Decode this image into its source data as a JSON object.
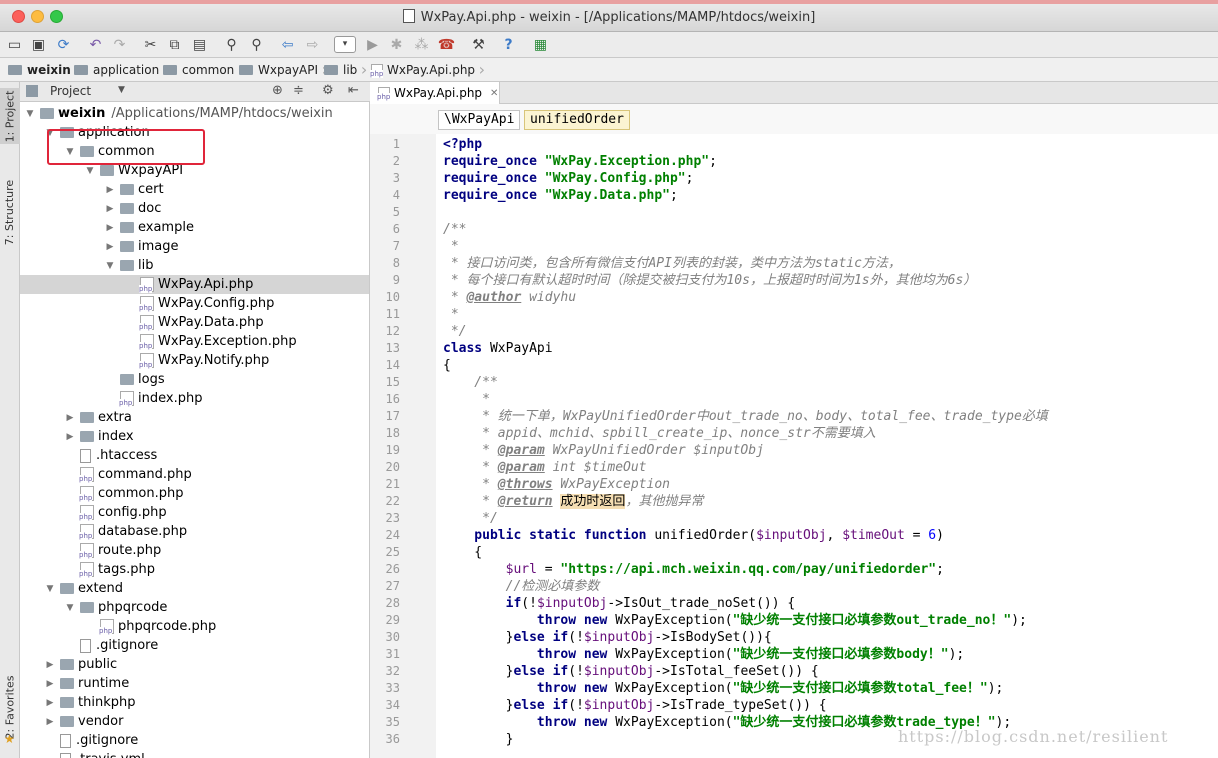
{
  "window": {
    "title": "WxPay.Api.php - weixin - [/Applications/MAMP/htdocs/weixin]"
  },
  "breadcrumbs": [
    "weixin",
    "application",
    "common",
    "WxpayAPI",
    "lib",
    "WxPay.Api.php"
  ],
  "left_tabs": {
    "project": "1: Project",
    "structure": "7: Structure",
    "favorites": "2: Favorites"
  },
  "project_panel": {
    "title": "Project",
    "root_name": "weixin",
    "root_path": "/Applications/MAMP/htdocs/weixin",
    "tree": [
      {
        "label": "application",
        "kind": "folder",
        "depth": 1,
        "open": true
      },
      {
        "label": "common",
        "kind": "folder",
        "depth": 2,
        "open": true
      },
      {
        "label": "WxpayAPI",
        "kind": "folder",
        "depth": 3,
        "open": true
      },
      {
        "label": "cert",
        "kind": "folder",
        "depth": 4,
        "open": false
      },
      {
        "label": "doc",
        "kind": "folder",
        "depth": 4,
        "open": false
      },
      {
        "label": "example",
        "kind": "folder",
        "depth": 4,
        "open": false
      },
      {
        "label": "image",
        "kind": "folder",
        "depth": 4,
        "open": false
      },
      {
        "label": "lib",
        "kind": "folder",
        "depth": 4,
        "open": true
      },
      {
        "label": "WxPay.Api.php",
        "kind": "php",
        "depth": 5,
        "selected": true
      },
      {
        "label": "WxPay.Config.php",
        "kind": "php",
        "depth": 5
      },
      {
        "label": "WxPay.Data.php",
        "kind": "php",
        "depth": 5
      },
      {
        "label": "WxPay.Exception.php",
        "kind": "php",
        "depth": 5
      },
      {
        "label": "WxPay.Notify.php",
        "kind": "php",
        "depth": 5
      },
      {
        "label": "logs",
        "kind": "folder",
        "depth": 4,
        "leaf": true
      },
      {
        "label": "index.php",
        "kind": "php",
        "depth": 4
      },
      {
        "label": "extra",
        "kind": "folder",
        "depth": 2,
        "open": false
      },
      {
        "label": "index",
        "kind": "folder",
        "depth": 2,
        "open": false
      },
      {
        "label": ".htaccess",
        "kind": "file",
        "depth": 2
      },
      {
        "label": "command.php",
        "kind": "php",
        "depth": 2
      },
      {
        "label": "common.php",
        "kind": "php",
        "depth": 2
      },
      {
        "label": "config.php",
        "kind": "php",
        "depth": 2
      },
      {
        "label": "database.php",
        "kind": "php",
        "depth": 2
      },
      {
        "label": "route.php",
        "kind": "php",
        "depth": 2
      },
      {
        "label": "tags.php",
        "kind": "php",
        "depth": 2
      },
      {
        "label": "extend",
        "kind": "folder",
        "depth": 1,
        "open": true
      },
      {
        "label": "phpqrcode",
        "kind": "folder",
        "depth": 2,
        "open": true
      },
      {
        "label": "phpqrcode.php",
        "kind": "php",
        "depth": 3
      },
      {
        "label": ".gitignore",
        "kind": "file",
        "depth": 2
      },
      {
        "label": "public",
        "kind": "folder",
        "depth": 1,
        "open": false
      },
      {
        "label": "runtime",
        "kind": "folder",
        "depth": 1,
        "open": false
      },
      {
        "label": "thinkphp",
        "kind": "folder",
        "depth": 1,
        "open": false
      },
      {
        "label": "vendor",
        "kind": "folder",
        "depth": 1,
        "open": false
      },
      {
        "label": ".gitignore",
        "kind": "file",
        "depth": 1
      },
      {
        "label": ".travis.yml",
        "kind": "file",
        "depth": 1
      }
    ]
  },
  "editor": {
    "tab_label": "WxPay.Api.php",
    "nav": {
      "class_chip": "\\WxPayApi",
      "method_chip": "unifiedOrder"
    },
    "first_line": 1,
    "lines": [
      [
        [
          "<?php",
          "kw"
        ]
      ],
      [
        [
          "require_once ",
          "kw"
        ],
        [
          "\"WxPay.Exception.php\"",
          "str"
        ],
        [
          ";",
          ""
        ]
      ],
      [
        [
          "require_once ",
          "kw"
        ],
        [
          "\"WxPay.Config.php\"",
          "str"
        ],
        [
          ";",
          ""
        ]
      ],
      [
        [
          "require_once ",
          "kw"
        ],
        [
          "\"WxPay.Data.php\"",
          "str"
        ],
        [
          ";",
          ""
        ]
      ],
      [],
      [
        [
          "/**",
          "cm"
        ]
      ],
      [
        [
          " *",
          "cm"
        ]
      ],
      [
        [
          " * 接口访问类，包含所有微信支付API列表的封装，类中方法为static方法，",
          "cm"
        ]
      ],
      [
        [
          " * 每个接口有默认超时时间（除提交被扫支付为10s，上报超时时间为1s外，其他均为6s）",
          "cm"
        ]
      ],
      [
        [
          " * ",
          "cm"
        ],
        [
          "@author",
          "tag"
        ],
        [
          " widyhu",
          "cm"
        ]
      ],
      [
        [
          " *",
          "cm"
        ]
      ],
      [
        [
          " */",
          "cm"
        ]
      ],
      [
        [
          "class ",
          "kw"
        ],
        [
          "WxPayApi",
          ""
        ]
      ],
      [
        [
          "{",
          ""
        ]
      ],
      [
        [
          "    /**",
          "cm"
        ]
      ],
      [
        [
          "     *",
          "cm"
        ]
      ],
      [
        [
          "     * 统一下单，WxPayUnifiedOrder中out_trade_no、body、total_fee、trade_type必填",
          "cm"
        ]
      ],
      [
        [
          "     * appid、mchid、spbill_create_ip、nonce_str不需要填入",
          "cm"
        ]
      ],
      [
        [
          "     * ",
          "cm"
        ],
        [
          "@param",
          "tag"
        ],
        [
          " WxPayUnifiedOrder $inputObj",
          "cm"
        ]
      ],
      [
        [
          "     * ",
          "cm"
        ],
        [
          "@param",
          "tag"
        ],
        [
          " int $timeOut",
          "cm"
        ]
      ],
      [
        [
          "     * ",
          "cm"
        ],
        [
          "@throws",
          "tag"
        ],
        [
          " WxPayException",
          "cm"
        ]
      ],
      [
        [
          "     * ",
          "cm"
        ],
        [
          "@return",
          "tag"
        ],
        [
          " ",
          "cm"
        ],
        [
          "成功时返回",
          "hl"
        ],
        [
          "，其他抛异常",
          "cm"
        ]
      ],
      [
        [
          "     */",
          "cm"
        ]
      ],
      [
        [
          "    public static function ",
          "kw"
        ],
        [
          "unifiedOrder(",
          ""
        ],
        [
          "$inputObj",
          "var"
        ],
        [
          ", ",
          ""
        ],
        [
          "$timeOut",
          "var"
        ],
        [
          " = ",
          ""
        ],
        [
          "6",
          "num"
        ],
        [
          ")",
          ""
        ]
      ],
      [
        [
          "    {",
          ""
        ]
      ],
      [
        [
          "        ",
          ""
        ],
        [
          "$url",
          "var"
        ],
        [
          " = ",
          ""
        ],
        [
          "\"https://api.mch.weixin.qq.com/pay/unifiedorder\"",
          "str"
        ],
        [
          ";",
          ""
        ]
      ],
      [
        [
          "        //检测必填参数",
          "cm"
        ]
      ],
      [
        [
          "        ",
          ""
        ],
        [
          "if",
          "kw"
        ],
        [
          "(!",
          ""
        ],
        [
          "$inputObj",
          "var"
        ],
        [
          "->IsOut_trade_noSet()) {",
          ""
        ]
      ],
      [
        [
          "            ",
          ""
        ],
        [
          "throw new ",
          "kw"
        ],
        [
          "WxPayException(",
          ""
        ],
        [
          "\"缺少统一支付接口必填参数out_trade_no！\"",
          "str"
        ],
        [
          ");",
          ""
        ]
      ],
      [
        [
          "        }",
          ""
        ],
        [
          "else if",
          "kw"
        ],
        [
          "(!",
          ""
        ],
        [
          "$inputObj",
          "var"
        ],
        [
          "->IsBodySet()){",
          ""
        ]
      ],
      [
        [
          "            ",
          ""
        ],
        [
          "throw new ",
          "kw"
        ],
        [
          "WxPayException(",
          ""
        ],
        [
          "\"缺少统一支付接口必填参数body！\"",
          "str"
        ],
        [
          ");",
          ""
        ]
      ],
      [
        [
          "        }",
          ""
        ],
        [
          "else if",
          "kw"
        ],
        [
          "(!",
          ""
        ],
        [
          "$inputObj",
          "var"
        ],
        [
          "->IsTotal_feeSet()) {",
          ""
        ]
      ],
      [
        [
          "            ",
          ""
        ],
        [
          "throw new ",
          "kw"
        ],
        [
          "WxPayException(",
          ""
        ],
        [
          "\"缺少统一支付接口必填参数total_fee！\"",
          "str"
        ],
        [
          ");",
          ""
        ]
      ],
      [
        [
          "        }",
          ""
        ],
        [
          "else if",
          "kw"
        ],
        [
          "(!",
          ""
        ],
        [
          "$inputObj",
          "var"
        ],
        [
          "->IsTrade_typeSet()) {",
          ""
        ]
      ],
      [
        [
          "            ",
          ""
        ],
        [
          "throw new ",
          "kw"
        ],
        [
          "WxPayException(",
          ""
        ],
        [
          "\"缺少统一支付接口必填参数trade_type！\"",
          "str"
        ],
        [
          ");",
          ""
        ]
      ],
      [
        [
          "        }",
          ""
        ]
      ]
    ]
  },
  "watermark": "https://blog.csdn.net/resilient",
  "colors": {
    "accent_red": "#e0253a",
    "selection": "#d5d5d5",
    "keyword": "#000080",
    "string": "#008000",
    "comment": "#808080"
  }
}
